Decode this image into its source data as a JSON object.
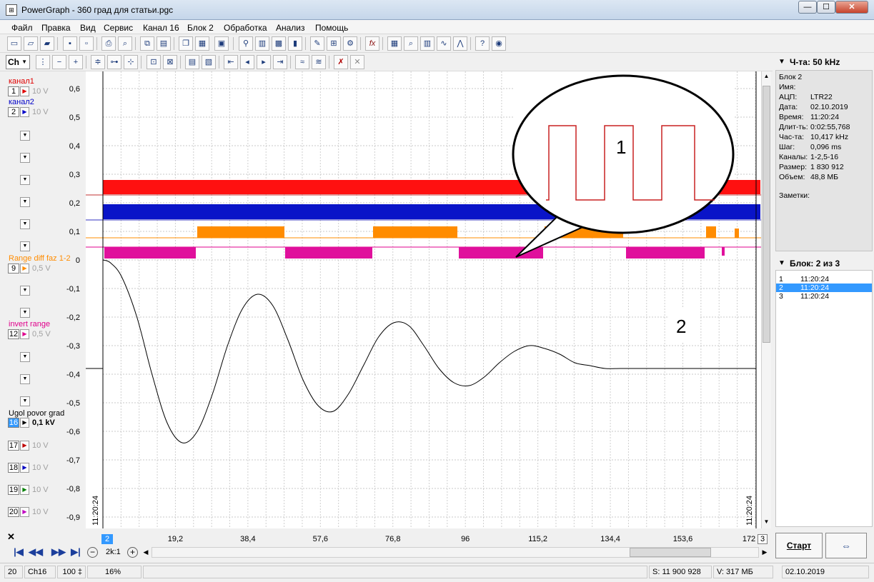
{
  "window": {
    "title": "PowerGraph - 360 град для статьи.pgc",
    "app_icon": "⊞",
    "minimize": "—",
    "maximize": "☐",
    "close": "✕"
  },
  "menu": [
    "Файл",
    "Правка",
    "Вид",
    "Сервис",
    "Канал 16",
    "Блок 2",
    "Обработка",
    "Анализ",
    "Помощь"
  ],
  "toolbar": {
    "channel_select": "Ch",
    "icons": [
      "new-file-icon",
      "open-icon",
      "open-recent-icon",
      "save-icon",
      "save-as-icon",
      "print-icon",
      "print-preview-icon",
      "copy-block-icon",
      "paste-block-icon",
      "copy-icon",
      "paste-icon",
      "properties-icon",
      "zoom-icon",
      "cursor-icon",
      "settings-icon",
      "edit-icon",
      "filter-icon",
      "function-fx-icon",
      "table-icon",
      "search-icon",
      "histogram-icon",
      "spectrum-icon",
      "statistics-icon",
      "help-icon",
      "globe-icon"
    ]
  },
  "channels": [
    {
      "label": "канал1",
      "num": "1",
      "scale": "10 V",
      "color": "#e00000"
    },
    {
      "label": "канал2",
      "num": "2",
      "scale": "10 V",
      "color": "#0000c8"
    },
    {
      "label": "Range diff faz 1-2",
      "num": "9",
      "scale": "0,5 V",
      "color": "#ff8c00"
    },
    {
      "label": "invert range",
      "num": "12",
      "scale": "0,5 V",
      "color": "#e0008c"
    },
    {
      "label": "Ugol povor grad",
      "num": "16",
      "scale": "0,1 kV",
      "color": "#000000"
    },
    {
      "label": "",
      "num": "17",
      "scale": "10 V",
      "color": "#c00000"
    },
    {
      "label": "",
      "num": "18",
      "scale": "10 V",
      "color": "#0000c0"
    },
    {
      "label": "",
      "num": "19",
      "scale": "10 V",
      "color": "#008000"
    },
    {
      "label": "",
      "num": "20",
      "scale": "10 V",
      "color": "#c000c0"
    }
  ],
  "plot": {
    "y_ticks": [
      "0,6",
      "0,5",
      "0,4",
      "0,3",
      "0,2",
      "0,1",
      "0",
      "-0,1",
      "-0,2",
      "-0,3",
      "-0,4",
      "-0,5",
      "-0,6",
      "-0,7",
      "-0,8",
      "-0,9"
    ],
    "y_values": [
      0.6,
      0.5,
      0.4,
      0.3,
      0.2,
      0.1,
      0,
      -0.1,
      -0.2,
      -0.3,
      -0.4,
      -0.5,
      -0.6,
      -0.7,
      -0.8,
      -0.9
    ],
    "x_ticks": [
      "19,2",
      "38,4",
      "57,6",
      "76,8",
      "96",
      "115,2",
      "134,4",
      "153,6",
      "172"
    ],
    "x_values": [
      19.2,
      38.4,
      57.6,
      76.8,
      96,
      115.2,
      134.4,
      153.6,
      172
    ],
    "start_time": "11:20:24",
    "end_time": "11:20:24",
    "callout_1": "1",
    "callout_2": "2",
    "block_left": "2",
    "block_right": "3"
  },
  "chart_data": {
    "type": "line",
    "title": "",
    "xlabel": "",
    "ylabel": "",
    "xlim": [
      0,
      173
    ],
    "ylim": [
      -0.97,
      0.66
    ],
    "series": [
      {
        "name": "Ugol povor grad",
        "x": [
          0,
          2,
          5,
          9,
          13,
          17,
          21,
          25,
          29,
          33,
          37,
          41,
          45,
          49,
          53,
          57,
          61,
          65,
          69,
          73,
          77,
          81,
          85,
          89,
          93,
          97,
          101,
          105,
          109,
          113,
          117,
          121,
          125,
          129,
          133,
          137,
          141,
          145,
          149,
          153,
          157,
          161,
          165,
          169,
          173
        ],
        "y": [
          0,
          -0.01,
          -0.06,
          -0.2,
          -0.4,
          -0.57,
          -0.64,
          -0.6,
          -0.47,
          -0.3,
          -0.17,
          -0.12,
          -0.16,
          -0.28,
          -0.42,
          -0.51,
          -0.53,
          -0.47,
          -0.37,
          -0.27,
          -0.22,
          -0.23,
          -0.3,
          -0.38,
          -0.43,
          -0.44,
          -0.41,
          -0.36,
          -0.32,
          -0.3,
          -0.31,
          -0.33,
          -0.36,
          -0.37,
          -0.38,
          -0.38,
          -0.38,
          -0.38,
          -0.38,
          -0.38,
          -0.38,
          -0.38,
          -0.38,
          -0.38,
          -0.38
        ]
      }
    ]
  },
  "info": {
    "header": "Ч-та: 50 kHz",
    "rows": [
      {
        "k": "Блок 2",
        "v": ""
      },
      {
        "k": "Имя:",
        "v": ""
      },
      {
        "k": "АЦП:",
        "v": "LTR22"
      },
      {
        "k": "Дата:",
        "v": "02.10.2019"
      },
      {
        "k": "Время:",
        "v": "11:20:24"
      },
      {
        "k": "Длит-ть:",
        "v": "0:02:55,768"
      },
      {
        "k": "Час-та:",
        "v": "10,417 kHz"
      },
      {
        "k": "Шаг:",
        "v": "0,096 ms"
      },
      {
        "k": "Каналы:",
        "v": "1-2,5-16"
      },
      {
        "k": "Размер:",
        "v": "1 830 912"
      },
      {
        "k": "Объем:",
        "v": "48,8 МБ"
      },
      {
        "k": "",
        "v": ""
      },
      {
        "k": "Заметки:",
        "v": ""
      }
    ]
  },
  "blocks": {
    "header": "Блок: 2 из 3",
    "items": [
      {
        "n": "1",
        "t": "11:20:24",
        "selected": false
      },
      {
        "n": "2",
        "t": "11:20:24",
        "selected": true
      },
      {
        "n": "3",
        "t": "11:20:24",
        "selected": false
      }
    ]
  },
  "buttons": {
    "start": "Старт"
  },
  "zoom": "2k:1",
  "status": {
    "block_count": "20",
    "channel": "Ch16",
    "percent": "100 ‡",
    "zoom_pct": "16%",
    "samples": "S: 11 900 928",
    "volume": "V: 317 МБ",
    "date": "02.10.2019"
  }
}
